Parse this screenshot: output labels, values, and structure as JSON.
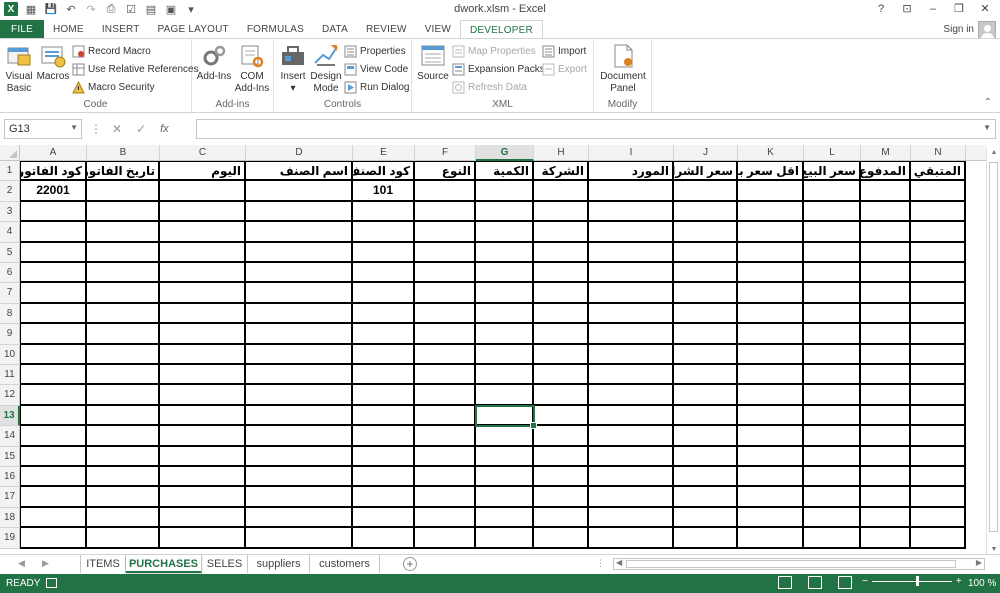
{
  "window": {
    "title": "dwork.xlsm - Excel",
    "help": "?",
    "minimize": "–",
    "restore": "❐",
    "close": "✕",
    "ribbon_display": "⊡"
  },
  "qat": {
    "save": "💾",
    "undo": "↶",
    "redo": "↷",
    "dropdown": "▾"
  },
  "tabs": [
    "FILE",
    "HOME",
    "INSERT",
    "PAGE LAYOUT",
    "FORMULAS",
    "DATA",
    "REVIEW",
    "VIEW",
    "DEVELOPER"
  ],
  "active_tab": "DEVELOPER",
  "signin": "Sign in",
  "ribbon": {
    "code": {
      "label": "Code",
      "visual_basic": [
        "Visual",
        "Basic"
      ],
      "macros": "Macros",
      "record_macro": "Record Macro",
      "relative_refs": "Use Relative References",
      "macro_security": "Macro Security"
    },
    "addins": {
      "label": "Add-ins",
      "addins": "Add-Ins",
      "com_addins": [
        "COM",
        "Add-Ins"
      ]
    },
    "controls": {
      "label": "Controls",
      "insert": "Insert",
      "design_mode": [
        "Design",
        "Mode"
      ],
      "properties": "Properties",
      "view_code": "View Code",
      "run_dialog": "Run Dialog"
    },
    "xml": {
      "label": "XML",
      "source": "Source",
      "map_properties": "Map Properties",
      "expansion_packs": "Expansion Packs",
      "refresh_data": "Refresh Data",
      "import": "Import",
      "export": "Export"
    },
    "modify": {
      "label": "Modify",
      "document_panel": [
        "Document",
        "Panel"
      ]
    }
  },
  "formula_bar": {
    "name_box": "G13",
    "fx": "fx",
    "cancel": "✕",
    "enter": "✓",
    "value": ""
  },
  "columns": [
    "A",
    "B",
    "C",
    "D",
    "E",
    "F",
    "G",
    "H",
    "I",
    "J",
    "K",
    "L",
    "M",
    "N"
  ],
  "selected_column": "G",
  "rows": [
    "1",
    "2",
    "3",
    "4",
    "5",
    "6",
    "7",
    "8",
    "9",
    "10",
    "11",
    "12",
    "13",
    "14",
    "15",
    "16",
    "17",
    "18",
    "19"
  ],
  "selected_row": "13",
  "headers": [
    "كود الفاتورة",
    "تاريخ الفاتورة",
    "اليوم",
    "اسم الصنف",
    "كود الصنف",
    "النوع",
    "الكمية",
    "الشركة",
    "المورد",
    "سعر الشراء",
    "اقل سعر بيع",
    "سعر البيع",
    "المدفوع",
    "المتبقي"
  ],
  "row2": {
    "A": "22001",
    "E": "101"
  },
  "sheets": [
    "ITEMS",
    "PURCHASES",
    "SELES",
    "suppliers",
    "customers"
  ],
  "active_sheet": "PURCHASES",
  "status": {
    "ready": "READY",
    "zoom": "100 %",
    "zoom_minus": "−",
    "zoom_plus": "+"
  },
  "colors": {
    "accent": "#217346"
  }
}
